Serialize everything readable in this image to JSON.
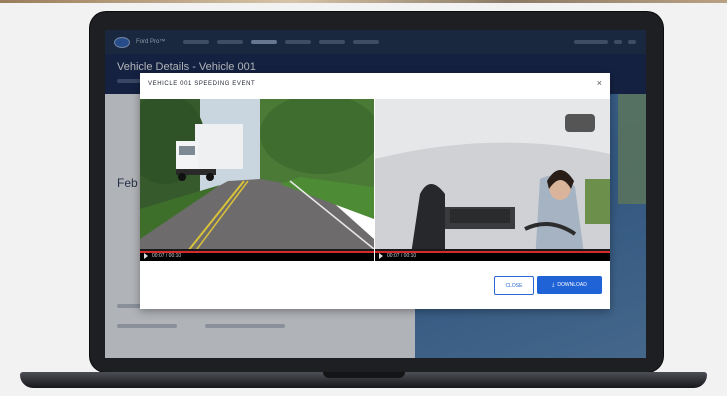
{
  "app": {
    "brand": "Ford Pro™",
    "vehicle_title": "Vehicle Details - Vehicle 001",
    "section_heading": "Feb"
  },
  "modal": {
    "title": "VEHICLE 001 SPEEDING EVENT",
    "close_icon": "×",
    "road_video": {
      "time": "00:07 / 00:10"
    },
    "cabin_video": {
      "time": "00:07 / 00:10"
    },
    "buttons": {
      "close": "CLOSE",
      "download": "DOWNLOAD",
      "download_icon": "⤓"
    }
  },
  "colors": {
    "nav": "#1a2a48",
    "header": "#10204a",
    "accent": "#1f63d6",
    "progress": "#d42a2a"
  }
}
